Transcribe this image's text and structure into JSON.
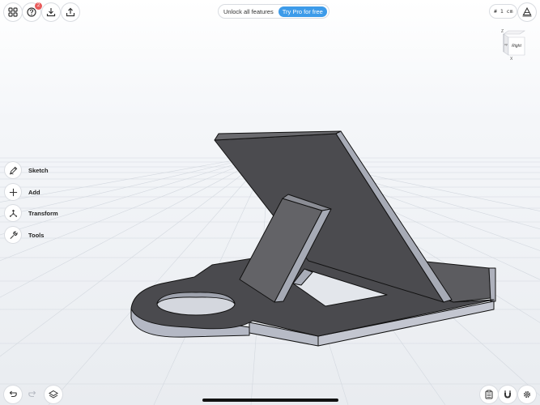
{
  "toolbar": {
    "help_badge_count": "2",
    "promo_text": "Unlock all features",
    "promo_button": "Try Pro for free",
    "grid_unit": "# 1 cm"
  },
  "viewcube": {
    "face_right": "Right",
    "face_side": "op",
    "axis_z": "Z",
    "axis_x": "X"
  },
  "tools": [
    {
      "label": "Sketch",
      "icon": "pencil-icon"
    },
    {
      "label": "Add",
      "icon": "plus-icon"
    },
    {
      "label": "Transform",
      "icon": "transform-icon"
    },
    {
      "label": "Tools",
      "icon": "wrench-icon"
    }
  ],
  "icons": {
    "top_left": [
      "grid-apps-icon",
      "help-icon",
      "download-icon",
      "share-icon"
    ],
    "top_right": [
      "lighting-icon"
    ],
    "bottom_left": [
      "undo-icon",
      "redo-icon",
      "layers-icon"
    ],
    "bottom_right": [
      "clipboard-icon",
      "magnet-icon",
      "settings-icon"
    ]
  }
}
